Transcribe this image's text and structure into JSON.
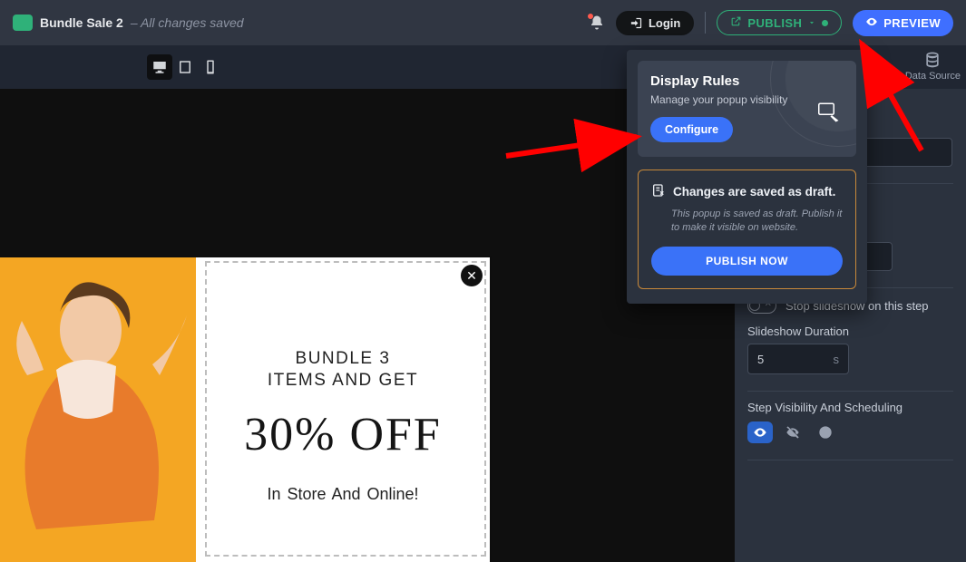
{
  "header": {
    "title": "Bundle Sale 2",
    "status_prefix": "– ",
    "status": "All changes saved",
    "login": "Login",
    "publish": "PUBLISH",
    "preview": "PREVIEW"
  },
  "toolbar": {
    "datasource": "Data Source"
  },
  "dropdown": {
    "display_rules_title": "Display Rules",
    "display_rules_sub": "Manage your popup visibility",
    "configure": "Configure",
    "draft_title": "Changes are saved as draft.",
    "draft_note": "This popup is saved as draft. Publish it to make it visible on website.",
    "publish_now": "PUBLISH NOW"
  },
  "sidebar": {
    "stop_slideshow": "Stop slideshow on this step",
    "duration_label": "Slideshow Duration",
    "duration_value": "5",
    "duration_unit": "s",
    "visibility_label": "Step Visibility And Scheduling"
  },
  "popup": {
    "line1": "BUNDLE 3",
    "line2": "ITEMS AND GET",
    "off": "30% OFF",
    "instore": "In Store And Online!",
    "close": "✕"
  }
}
